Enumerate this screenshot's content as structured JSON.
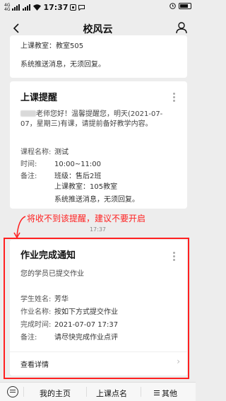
{
  "status_bar": {
    "signal1": "4G",
    "signal2": "4G",
    "time": "17:37",
    "battery_icon": "battery-icon"
  },
  "nav": {
    "title": "校风云",
    "back_icon": "back-chevron-icon",
    "profile_icon": "person-icon"
  },
  "top_card": {
    "rows": [
      {
        "key": "",
        "value": "上课教室：教室505"
      },
      {
        "key": "",
        "value": "系统推送消息，无须回复。"
      }
    ]
  },
  "class_reminder": {
    "title": "上课提醒",
    "desc_prefix": "老师您好！温馨提醒您，明天(2021-07-07，星期三)有课，请提前备好教学内容。",
    "rows": [
      {
        "key": "课程名称:",
        "value": "测试"
      },
      {
        "key": "时间:",
        "value": "10:00~11:00"
      },
      {
        "key": "备注:",
        "value": "班级：售后2班"
      },
      {
        "key": "",
        "value": "上课教室：105教室"
      },
      {
        "key": "",
        "value": "系统推送消息，无须回复。"
      }
    ]
  },
  "annotation": {
    "text": "将收不到该提醒，建议不要开启",
    "color": "#ff1f1f"
  },
  "message_time": "17:37",
  "homework_card": {
    "title": "作业完成通知",
    "subtitle": "您的学员已提交作业",
    "rows": [
      {
        "key": "学生姓名:",
        "value": "芳华"
      },
      {
        "key": "作业名称:",
        "value": "按如下方式提交作业"
      },
      {
        "key": "完成时间:",
        "value": "2021-07-07 17:37"
      },
      {
        "key": "备注:",
        "value": "请尽快完成作业点评"
      }
    ],
    "link": "查看详情"
  },
  "bottom_menu": {
    "items": [
      "我的主页",
      "上课点名",
      "其他"
    ]
  }
}
